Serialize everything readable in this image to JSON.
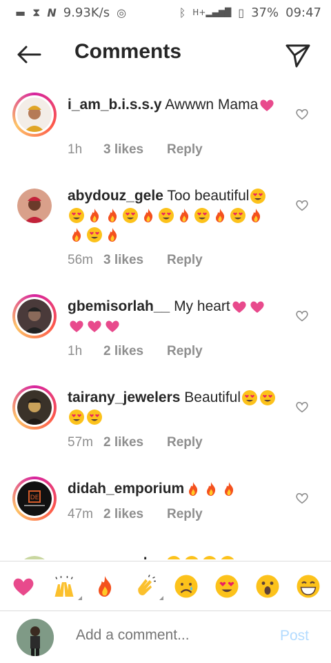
{
  "status": {
    "speed": "9.93K/s",
    "network": "H+",
    "battery": "37%",
    "time": "09:47"
  },
  "header": {
    "title": "Comments",
    "back_icon": "arrow-left-icon",
    "send_icon": "paper-plane-icon"
  },
  "comments": [
    {
      "user": "i_am_b.i.s.s.y",
      "text": "Awwwn Mama",
      "time": "1h",
      "likes": "3 likes",
      "reply": "Reply",
      "emojis": [
        "pink-heart"
      ]
    },
    {
      "user": "abydouz_gele",
      "text": "Too beautiful",
      "time": "56m",
      "likes": "3 likes",
      "reply": "Reply",
      "emojis": [
        "heart-eyes",
        "heart-eyes",
        "fire",
        "fire",
        "heart-eyes",
        "fire",
        "heart-eyes",
        "fire",
        "heart-eyes",
        "fire",
        "heart-eyes",
        "fire",
        "fire",
        "heart-eyes",
        "fire"
      ]
    },
    {
      "user": "gbemisorlah__",
      "text": "My heart",
      "time": "1h",
      "likes": "2 likes",
      "reply": "Reply",
      "emojis": [
        "pink-heart",
        "pink-heart",
        "pink-heart",
        "pink-heart",
        "pink-heart"
      ]
    },
    {
      "user": "tairany_jewelers",
      "text": "Beautiful",
      "time": "57m",
      "likes": "2 likes",
      "reply": "Reply",
      "emojis": [
        "heart-eyes",
        "heart-eyes",
        "heart-eyes",
        "heart-eyes"
      ]
    },
    {
      "user": "didah_emporium",
      "text": "",
      "time": "47m",
      "likes": "2 likes",
      "reply": "Reply",
      "emojis": [
        "fire",
        "fire",
        "fire"
      ]
    },
    {
      "user": "awagu_parker",
      "text": "",
      "time": "",
      "likes": "",
      "reply": "",
      "emojis": [
        "heart-eyes",
        "heart-eyes",
        "heart-eyes",
        "heart-eyes"
      ]
    }
  ],
  "quick_reactions": [
    "pink-heart",
    "raised-hands",
    "fire",
    "clapping-hands",
    "sad-face",
    "heart-eyes",
    "surprised-face",
    "grinning-face"
  ],
  "composer": {
    "placeholder": "Add a comment...",
    "post_label": "Post"
  },
  "colors": {
    "post_disabled": "#b3dbff",
    "meta_gray": "#8e8e8e",
    "ring_gradient": "#d6249f"
  }
}
